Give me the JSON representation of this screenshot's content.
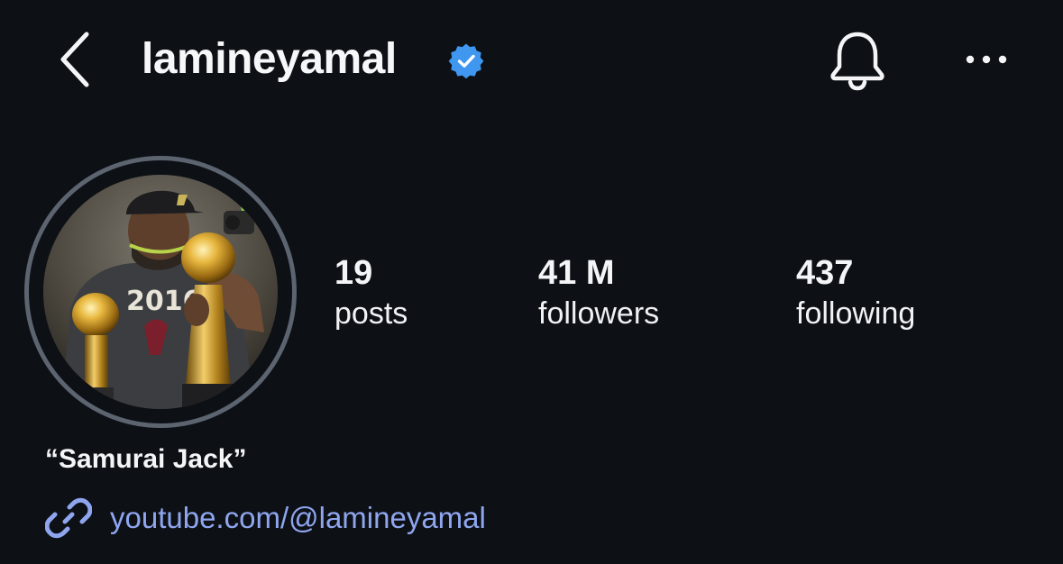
{
  "header": {
    "username": "lamineyamal",
    "verified": true,
    "back_icon": "chevron-left-icon",
    "notification_icon": "bell-icon",
    "more_icon": "more-horizontal-icon"
  },
  "profile": {
    "avatar": "profile-photo",
    "stats": {
      "posts": {
        "value": "19",
        "label": "posts"
      },
      "followers": {
        "value": "41 M",
        "label": "followers"
      },
      "following": {
        "value": "437",
        "label": "following"
      }
    },
    "name": "“Samurai Jack”",
    "link": {
      "icon": "link-icon",
      "text": "youtube.com/@lamineyamal"
    }
  },
  "colors": {
    "background": "#0d1015",
    "text": "#f3f5f7",
    "verified_badge": "#3f97f0",
    "link": "#8fa6ef",
    "avatar_ring": "#5c6470"
  }
}
